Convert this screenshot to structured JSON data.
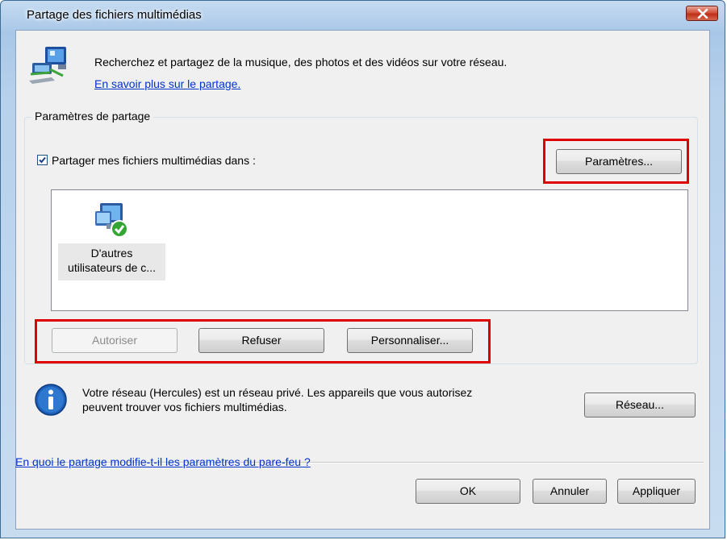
{
  "window": {
    "title": "Partage des fichiers multimédias"
  },
  "header": {
    "description": "Recherchez et partagez de la musique, des photos et des vidéos sur votre réseau.",
    "learn_more_link": "En savoir plus sur le partage."
  },
  "sharing_settings": {
    "group_label": "Paramètres de partage",
    "share_checkbox_label": "Partager mes fichiers multimédias dans :",
    "share_checkbox_checked": true,
    "settings_button": "Paramètres...",
    "devices": [
      {
        "label_line1": "D'autres",
        "label_line2": "utilisateurs de c..."
      }
    ],
    "allow_button": "Autoriser",
    "deny_button": "Refuser",
    "customize_button": "Personnaliser..."
  },
  "network": {
    "info_line1": "Votre réseau (Hercules) est un réseau privé. Les appareils que vous autorisez",
    "info_line2": "peuvent trouver vos fichiers multimédias.",
    "network_button": "Réseau..."
  },
  "footer": {
    "firewall_link": "En quoi le partage modifie-t-il les paramètres du pare-feu ?",
    "ok_button": "OK",
    "cancel_button": "Annuler",
    "apply_button": "Appliquer"
  },
  "colors": {
    "highlight": "#e00000",
    "link": "#0033cc",
    "title_gradient_top": "#c5dbf1"
  }
}
